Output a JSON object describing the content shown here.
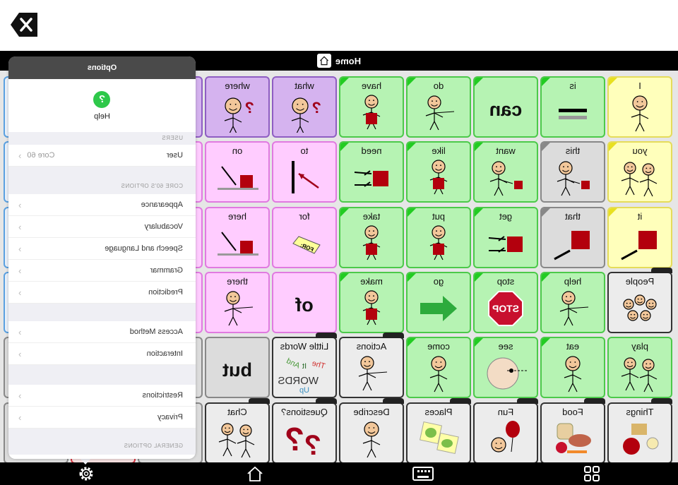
{
  "window": {
    "close_icon": "x-icon"
  },
  "title_bar": {
    "title": "Home",
    "home_icon": "home-icon"
  },
  "colors": {
    "core_green": "#b6f3b3",
    "pronoun_yellow": "#ffffbb",
    "preposition_pink": "#ffccff",
    "question_purple": "#d5b3ef",
    "determiner_gray": "#dcdcdc",
    "folder_gray": "#ececec"
  },
  "grid": {
    "rows": [
      [
        {
          "label": "I",
          "type": "yellow",
          "icon": "face-self"
        },
        {
          "label": "is",
          "type": "green",
          "icon": "equals"
        },
        {
          "label": "",
          "type": "green",
          "big": "can"
        },
        {
          "label": "do",
          "type": "green",
          "icon": "face-reach"
        },
        {
          "label": "have",
          "type": "green",
          "icon": "face-hold"
        },
        {
          "label": "what",
          "type": "purple",
          "icon": "face-question"
        },
        {
          "label": "where",
          "type": "purple",
          "icon": "face-question"
        },
        {
          "label": "",
          "type": "purple"
        },
        {
          "label": "",
          "type": "gray"
        },
        {
          "label": "",
          "type": "blue"
        }
      ],
      [
        {
          "label": "you",
          "type": "yellow",
          "icon": "two-faces"
        },
        {
          "label": "this",
          "type": "gray",
          "icon": "face-point-square"
        },
        {
          "label": "want",
          "type": "green",
          "icon": "face-point-square"
        },
        {
          "label": "like",
          "type": "green",
          "icon": "face-hold"
        },
        {
          "label": "need",
          "type": "green",
          "icon": "square-hands"
        },
        {
          "label": "to",
          "type": "pink",
          "icon": "arrow-to"
        },
        {
          "label": "on",
          "type": "pink",
          "icon": "square-on"
        },
        {
          "label": "",
          "type": "pink"
        },
        {
          "label": "",
          "type": "gray"
        },
        {
          "label": "",
          "type": "blue"
        }
      ],
      [
        {
          "label": "it",
          "type": "yellow",
          "icon": "square-point"
        },
        {
          "label": "that",
          "type": "gray",
          "icon": "square-point"
        },
        {
          "label": "get",
          "type": "green",
          "icon": "square-hands"
        },
        {
          "label": "put",
          "type": "green",
          "icon": "face-hold"
        },
        {
          "label": "take",
          "type": "green",
          "icon": "face-hold"
        },
        {
          "label": "for",
          "type": "pink",
          "icon": "tag-for"
        },
        {
          "label": "here",
          "type": "pink",
          "icon": "square-on"
        },
        {
          "label": "",
          "type": "pink"
        },
        {
          "label": "",
          "type": "gray"
        },
        {
          "label": "",
          "type": "blue"
        }
      ],
      [
        {
          "label": "People",
          "type": "folder",
          "icon": "people"
        },
        {
          "label": "help",
          "type": "green",
          "icon": "face-reach"
        },
        {
          "label": "stop",
          "type": "green",
          "icon": "stop-sign"
        },
        {
          "label": "go",
          "type": "green",
          "icon": "green-arrow"
        },
        {
          "label": "make",
          "type": "green",
          "icon": "face-hold"
        },
        {
          "label": "",
          "type": "pink",
          "big": "of"
        },
        {
          "label": "there",
          "type": "pink",
          "icon": "face-reach"
        },
        {
          "label": "",
          "type": "pink"
        },
        {
          "label": "",
          "type": "gray"
        },
        {
          "label": "",
          "type": "blue"
        }
      ],
      [
        {
          "label": "play",
          "type": "green",
          "icon": "two-faces"
        },
        {
          "label": "eat",
          "type": "green",
          "icon": "face-self"
        },
        {
          "label": "see",
          "type": "green",
          "icon": "face-see"
        },
        {
          "label": "come",
          "type": "green",
          "icon": "face-self"
        },
        {
          "label": "Actions",
          "type": "folder",
          "icon": "face-reach"
        },
        {
          "label": "Little Words",
          "type": "folder",
          "icon": "words",
          "words": [
            "And",
            "It",
            "The",
            "WORDS",
            "Up"
          ]
        },
        {
          "label": "",
          "type": "gray",
          "big": "but"
        },
        {
          "label": "",
          "type": "gray"
        },
        {
          "label": "",
          "type": "gray"
        },
        {
          "label": "",
          "type": "gray"
        }
      ],
      [
        {
          "label": "Things",
          "type": "folder",
          "icon": "ball"
        },
        {
          "label": "Food",
          "type": "folder",
          "icon": "food"
        },
        {
          "label": "Fun",
          "type": "folder",
          "icon": "balloon"
        },
        {
          "label": "Places",
          "type": "folder",
          "icon": "maps"
        },
        {
          "label": "Describe",
          "type": "folder",
          "icon": "face-self"
        },
        {
          "label": "Questions?",
          "type": "folder",
          "icon": "question-marks"
        },
        {
          "label": "Chat",
          "type": "folder",
          "icon": "two-faces"
        },
        {
          "label": "",
          "type": "gray"
        },
        {
          "label": "",
          "type": "red"
        },
        {
          "label": "",
          "type": "gray"
        }
      ]
    ]
  },
  "options_panel": {
    "title": "Options",
    "help_label": "Help",
    "help_icon": "question-circle-icon",
    "users_header": "USERS",
    "user_label": "User",
    "user_value": "Core 60",
    "core_header": "CORE 60'S OPTIONS",
    "core_items": [
      "Appearance",
      "Vocabulary",
      "Speech and Language",
      "Grammar",
      "Prediction"
    ],
    "access_items": [
      "Access Method",
      "Interaction"
    ],
    "policy_items": [
      "Restrictions",
      "Privacy"
    ],
    "general_header": "GENERAL OPTIONS"
  },
  "bottom_bar": {
    "icons": [
      "grid-icon",
      "keyboard-icon",
      "home-icon",
      "gear-icon"
    ]
  }
}
